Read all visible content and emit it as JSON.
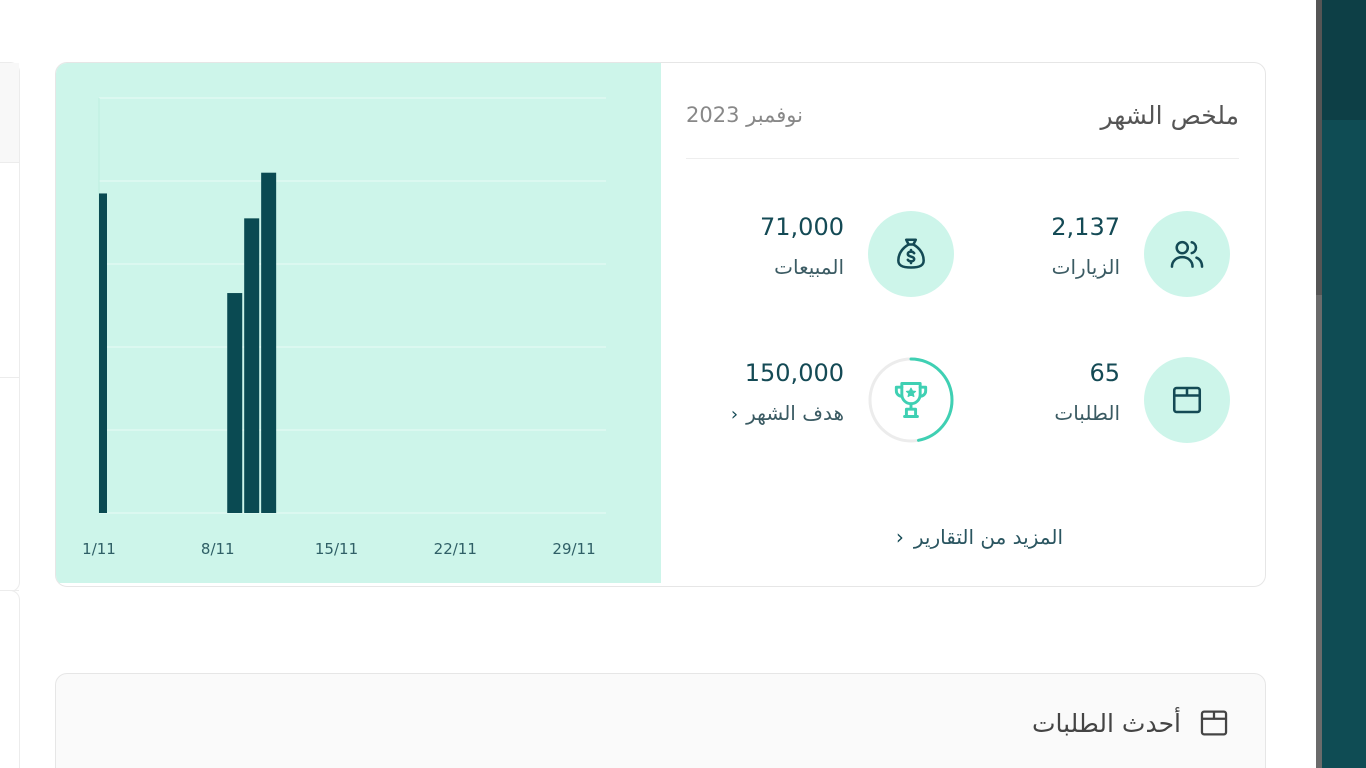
{
  "summary": {
    "title": "ملخص الشهر",
    "date": "نوفمبر 2023",
    "stats": {
      "visits": {
        "value": "2,137",
        "label": "الزيارات",
        "icon": "users-icon"
      },
      "sales": {
        "value": "71,000",
        "label": "المبيعات",
        "icon": "money-bag-icon"
      },
      "orders": {
        "value": "65",
        "label": "الطلبات",
        "icon": "box-icon"
      },
      "goal": {
        "value": "150,000",
        "label": "هدف الشهر",
        "icon": "trophy-icon",
        "progress": 0.47
      }
    },
    "more_link": "المزيد من التقارير",
    "chevron": "‹"
  },
  "latest_orders": {
    "title": "أحدث الطلبات",
    "icon": "box-icon"
  },
  "colors": {
    "chart_bg": "#cdf5ea",
    "bar": "#0a4a52",
    "accent": "#3fd0b3",
    "dark_panel": "#0f4c54"
  },
  "chart_data": {
    "type": "bar",
    "tick_labels": [
      "1/11",
      "8/11",
      "15/11",
      "22/11",
      "29/11"
    ],
    "points": [
      {
        "day": 1,
        "value": 77
      },
      {
        "day": 9,
        "value": 53
      },
      {
        "day": 10,
        "value": 71
      },
      {
        "day": 11,
        "value": 82
      }
    ],
    "xlim": [
      1,
      30
    ],
    "ylim": [
      0,
      100
    ],
    "grid": true
  }
}
